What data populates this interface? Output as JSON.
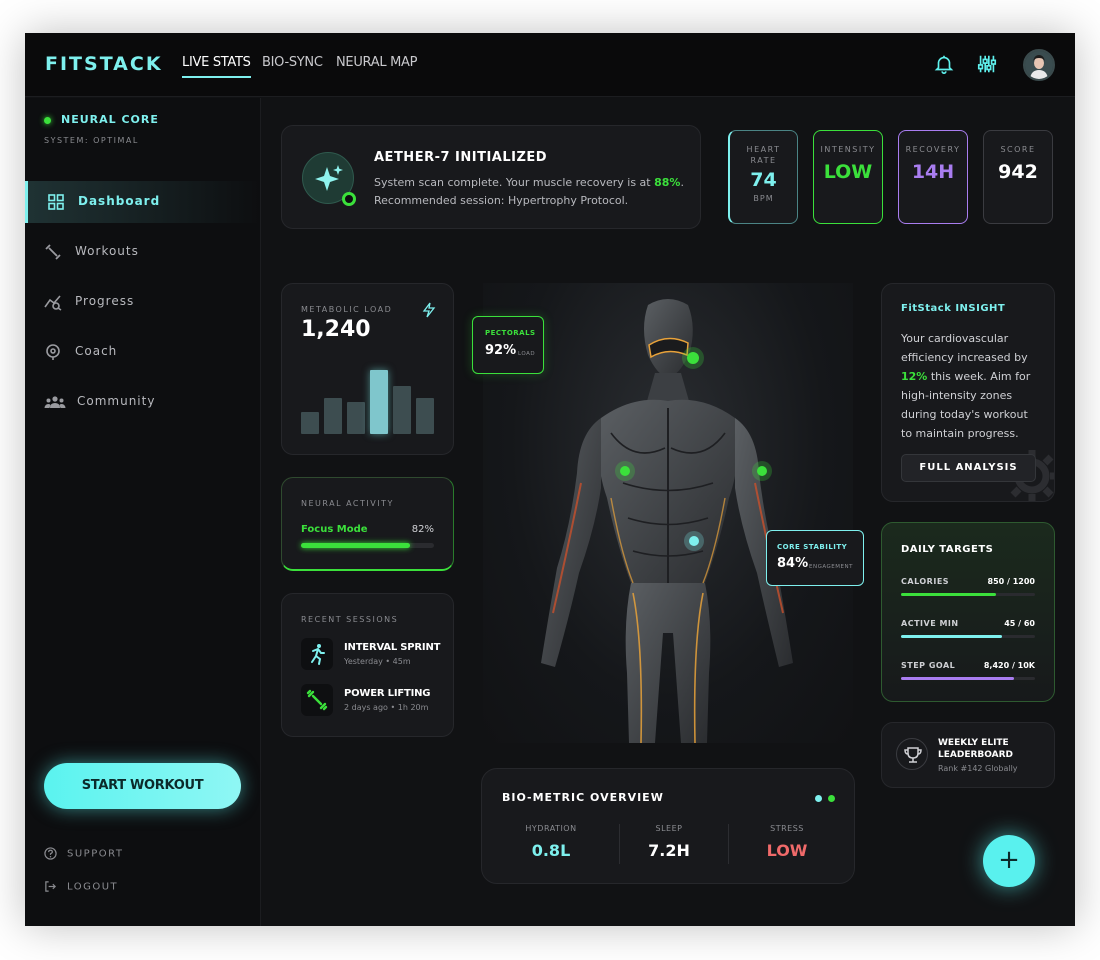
{
  "app": {
    "logo": "FITSTACK"
  },
  "topnav": [
    {
      "label": "LIVE STATS"
    },
    {
      "label": "BIO-SYNC"
    },
    {
      "label": "NEURAL MAP"
    }
  ],
  "top_icons": [
    "bell-icon",
    "equalizer-icon",
    "avatar"
  ],
  "sidebar": {
    "status_title": "NEURAL CORE",
    "status_sub": "SYSTEM: OPTIMAL",
    "items": [
      {
        "label": "Dashboard",
        "icon": "grid-icon"
      },
      {
        "label": "Workouts",
        "icon": "dumbbell-icon"
      },
      {
        "label": "Progress",
        "icon": "trend-icon"
      },
      {
        "label": "Coach",
        "icon": "coach-icon"
      },
      {
        "label": "Community",
        "icon": "community-icon"
      }
    ],
    "cta": "START WORKOUT",
    "support": "SUPPORT",
    "logout": "LOGOUT"
  },
  "alert": {
    "title": "AETHER-7 INITIALIZED",
    "line1_pre": "System scan complete. Your muscle recovery is at ",
    "line1_value": "88%",
    "line1_post": ".",
    "line2": "Recommended session: Hypertrophy Protocol."
  },
  "stats": [
    {
      "label1": "HEART",
      "label2": "RATE",
      "value": "74",
      "unit": "BPM",
      "color": "#7ef0ee"
    },
    {
      "label1": "INTENSITY",
      "label2": "",
      "value": "LOW",
      "unit": "",
      "color": "#3be03b"
    },
    {
      "label1": "RECOVERY",
      "label2": "",
      "value": "14H",
      "unit": "",
      "color": "#a97df0"
    },
    {
      "label1": "SCORE",
      "label2": "",
      "value": "942",
      "unit": "",
      "color": "#ffffff"
    }
  ],
  "metabolic": {
    "label": "METABOLIC LOAD",
    "value": "1,240",
    "bars": [
      22,
      36,
      32,
      64,
      48,
      36
    ],
    "highlight_index": 3
  },
  "neural": {
    "label": "NEURAL ACTIVITY",
    "mode": "Focus Mode",
    "percent_text": "82%",
    "percent": 82
  },
  "sessions": {
    "label": "RECENT SESSIONS",
    "items": [
      {
        "name": "INTERVAL SPRINT",
        "meta": "Yesterday • 45m",
        "icon": "runner-icon"
      },
      {
        "name": "POWER LIFTING",
        "meta": "2 days ago • 1h 20m",
        "icon": "dumbbell-icon"
      }
    ]
  },
  "tags": {
    "pectorals": {
      "name": "PECTORALS",
      "value": "92%",
      "unit": "LOAD"
    },
    "core": {
      "name": "CORE STABILITY",
      "value": "84%",
      "unit": "ENGAGEMENT"
    }
  },
  "insight": {
    "title": "FitStack INSIGHT",
    "body_pre": "Your cardiovascular efficiency increased by ",
    "body_value": "12%",
    "body_post": " this week. Aim for high-intensity zones during today's workout to maintain progress.",
    "button": "FULL ANALYSIS"
  },
  "targets": {
    "title": "DAILY TARGETS",
    "items": [
      {
        "label": "CALORIES",
        "value": "850 / 1200",
        "fraction": 0.708,
        "color": "#3be03b"
      },
      {
        "label": "ACTIVE MIN",
        "value": "45 / 60",
        "fraction": 0.75,
        "color": "#7ef0ee"
      },
      {
        "label": "STEP GOAL",
        "value": "8,420 / 10K",
        "fraction": 0.842,
        "color": "#a97df0"
      }
    ]
  },
  "leaderboard": {
    "title1": "WEEKLY ELITE",
    "title2": "LEADERBOARD",
    "rank": "Rank #142 Globally"
  },
  "bio": {
    "title": "BIO-METRIC OVERVIEW",
    "items": [
      {
        "label": "HYDRATION",
        "value": "0.8L",
        "color": "#7ef0ee"
      },
      {
        "label": "SLEEP",
        "value": "7.2H",
        "color": "#ffffff"
      },
      {
        "label": "STRESS",
        "value": "LOW",
        "color": "#f06a6a"
      }
    ]
  },
  "fab": "+"
}
